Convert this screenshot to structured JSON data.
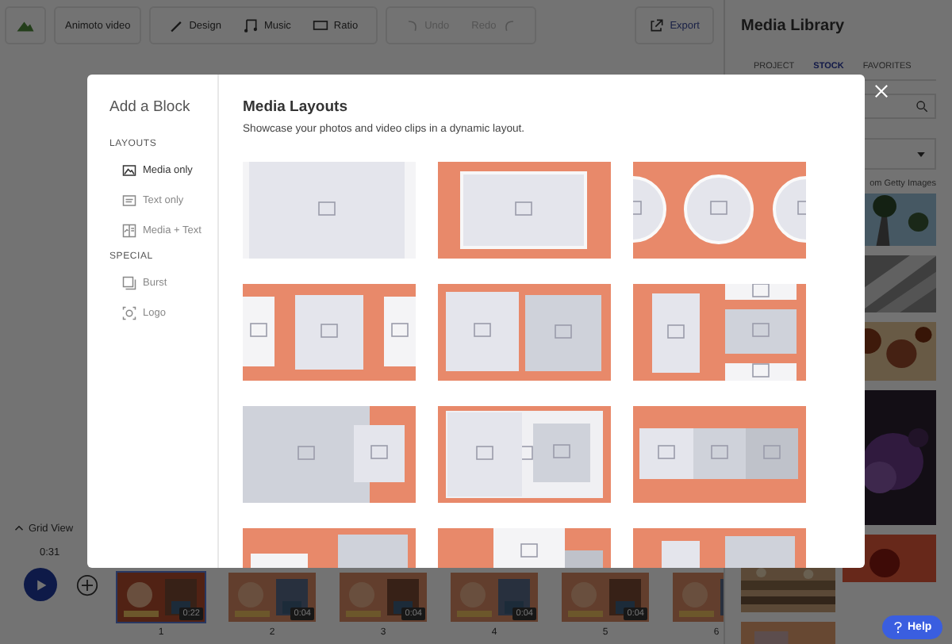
{
  "toolbar": {
    "project_title": "Animoto video",
    "tools": [
      {
        "label": "Design",
        "kind": "design"
      },
      {
        "label": "Music",
        "kind": "music"
      },
      {
        "label": "Ratio",
        "kind": "ratio"
      }
    ],
    "history": [
      {
        "label": "Undo",
        "kind": "undo",
        "disabled": true
      },
      {
        "label": "Redo",
        "kind": "redo",
        "disabled": true
      }
    ],
    "export": "Export"
  },
  "media_library": {
    "title": "Media Library",
    "tabs": [
      {
        "label": "PROJECT",
        "selected": false
      },
      {
        "label": "STOCK",
        "selected": true
      },
      {
        "label": "FAVORITES",
        "selected": false
      }
    ],
    "source_note": "om Getty Images"
  },
  "timeline": {
    "grid_view": "Grid View",
    "total_duration": "0:31",
    "clips": [
      {
        "number": "1",
        "duration": "0:22",
        "selected": true
      },
      {
        "number": "2",
        "duration": "0:04",
        "selected": false
      },
      {
        "number": "3",
        "duration": "0:04",
        "selected": false
      },
      {
        "number": "4",
        "duration": "0:04",
        "selected": false
      },
      {
        "number": "5",
        "duration": "0:04",
        "selected": false
      },
      {
        "number": "6",
        "selected": false
      }
    ]
  },
  "modal": {
    "title": "Add a Block",
    "sections": [
      {
        "heading": "LAYOUTS",
        "items": [
          {
            "label": "Media only",
            "kind": "media",
            "selected": true
          },
          {
            "label": "Text only",
            "kind": "text",
            "selected": false
          },
          {
            "label": "Media + Text",
            "kind": "media-text",
            "selected": false
          }
        ]
      },
      {
        "heading": "SPECIAL",
        "items": [
          {
            "label": "Burst",
            "kind": "burst",
            "selected": false
          },
          {
            "label": "Logo",
            "kind": "logo",
            "selected": false
          }
        ]
      }
    ],
    "content_title": "Media Layouts",
    "content_subtitle": "Showcase your photos and video clips in a dynamic layout.",
    "layouts": [
      {
        "kind": "full"
      },
      {
        "kind": "framed"
      },
      {
        "kind": "circles"
      },
      {
        "kind": "carousel"
      },
      {
        "kind": "pair"
      },
      {
        "kind": "stack"
      },
      {
        "kind": "split"
      },
      {
        "kind": "duo"
      },
      {
        "kind": "trio"
      },
      {
        "kind": "offset"
      },
      {
        "kind": "strip"
      },
      {
        "kind": "tall"
      }
    ]
  },
  "help": "Help"
}
